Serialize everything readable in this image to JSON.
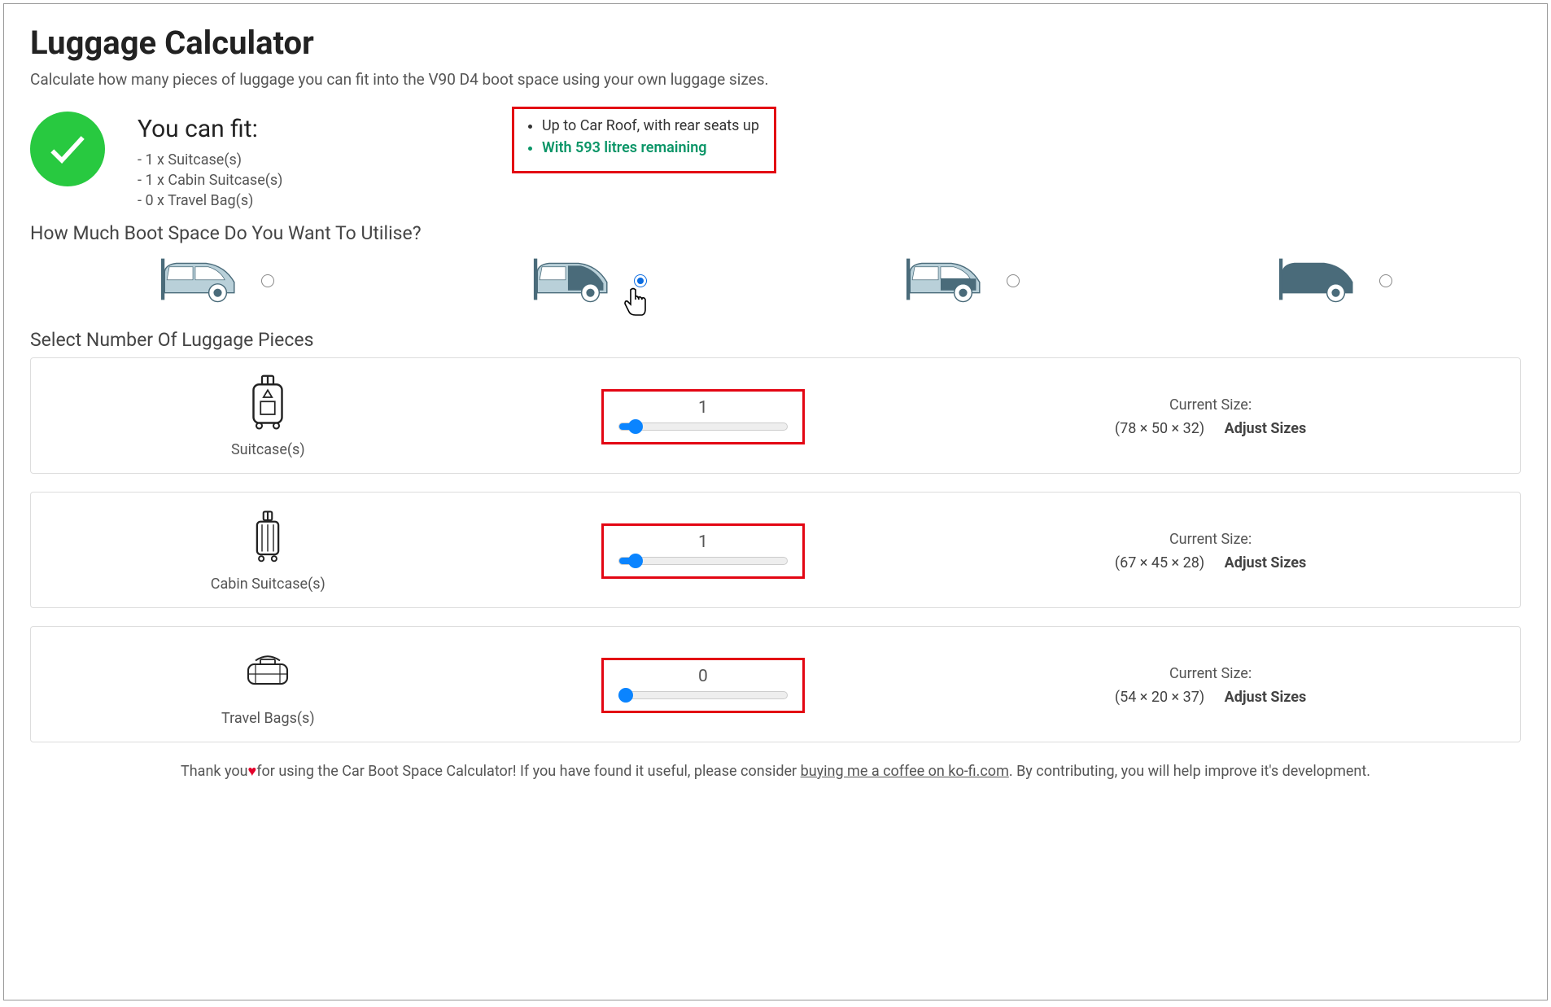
{
  "title": "Luggage Calculator",
  "subtitle": "Calculate how many pieces of luggage you can fit into the V90 D4 boot space using your own luggage sizes.",
  "fit": {
    "heading": "You can fit:",
    "items": [
      "- 1 x Suitcase(s)",
      "- 1 x Cabin Suitcase(s)",
      "- 0 x Travel Bag(s)"
    ],
    "note_config": "Up to Car Roof, with rear seats up",
    "note_remaining": "With 593 litres remaining"
  },
  "boot_heading": "How Much Boot Space Do You Want To Utilise?",
  "boot_options": [
    {
      "selected": false
    },
    {
      "selected": true
    },
    {
      "selected": false
    },
    {
      "selected": false
    }
  ],
  "luggage_heading": "Select Number Of Luggage Pieces",
  "size_label": "Current Size:",
  "adjust_label": "Adjust Sizes",
  "luggage": [
    {
      "name": "Suitcase(s)",
      "value": "1",
      "dims": "(78 × 50 × 32)",
      "fill_pct": 10
    },
    {
      "name": "Cabin Suitcase(s)",
      "value": "1",
      "dims": "(67 × 45 × 28)",
      "fill_pct": 10
    },
    {
      "name": "Travel Bags(s)",
      "value": "0",
      "dims": "(54 × 20 × 37)",
      "fill_pct": 0
    }
  ],
  "footer": {
    "pre": "Thank you",
    "mid": "for using the Car Boot Space Calculator! If you have found it useful, please consider ",
    "link": "buying me a coffee on ko-fi.com",
    "post": ". By contributing, you will help improve it's development."
  }
}
